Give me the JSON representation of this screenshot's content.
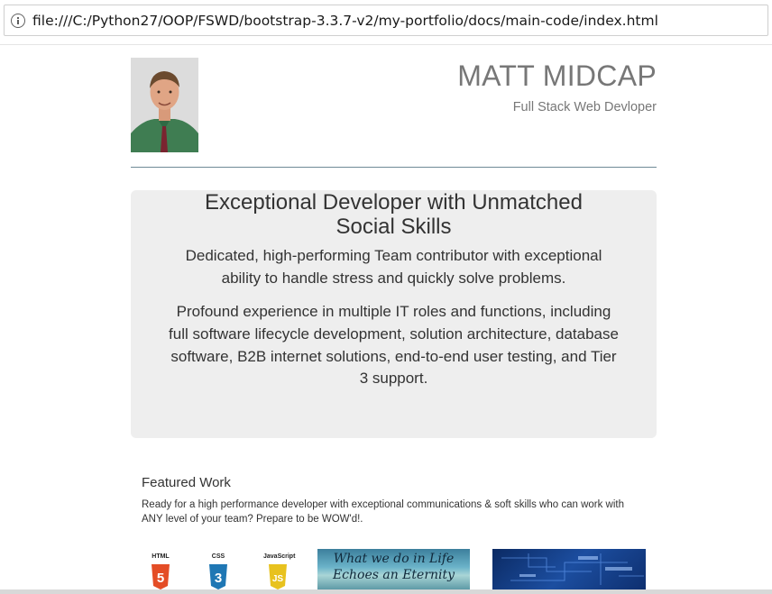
{
  "browser": {
    "url": "file:///C:/Python27/OOP/FSWD/bootstrap-3.3.7-v2/my-portfolio/docs/main-code/index.html"
  },
  "header": {
    "name": "MATT MIDCAP",
    "tagline": "Full Stack Web Devloper"
  },
  "jumbotron": {
    "title": "Exceptional Developer with Unmatched Social Skills",
    "paragraph_1": "Dedicated, high-performing Team contributor with exceptional ability to handle stress and quickly solve problems.",
    "paragraph_2": "Profound experience in multiple IT roles and functions, including full software lifecycle development, solution architecture, database software, B2B internet solutions, end-to-end user testing, and Tier 3 support."
  },
  "featured": {
    "title": "Featured Work",
    "description": "Ready for a high performance developer with exceptional communications & soft skills who can work with ANY level of your team? Prepare to be WOW'd!.",
    "tech": [
      {
        "label": "HTML",
        "glyph": "5",
        "color": "#e44d26"
      },
      {
        "label": "CSS",
        "glyph": "3",
        "color": "#1f77b4"
      },
      {
        "label": "JavaScript",
        "glyph": "JS",
        "color": "#e8c21e"
      }
    ],
    "thumb_life": {
      "line1": "What we do in Life",
      "line2": "Echoes an Eternity"
    }
  },
  "colors": {
    "jumbotron_bg": "#eeeeee",
    "heading_gray": "#777777",
    "divider": "#6f8a96"
  }
}
